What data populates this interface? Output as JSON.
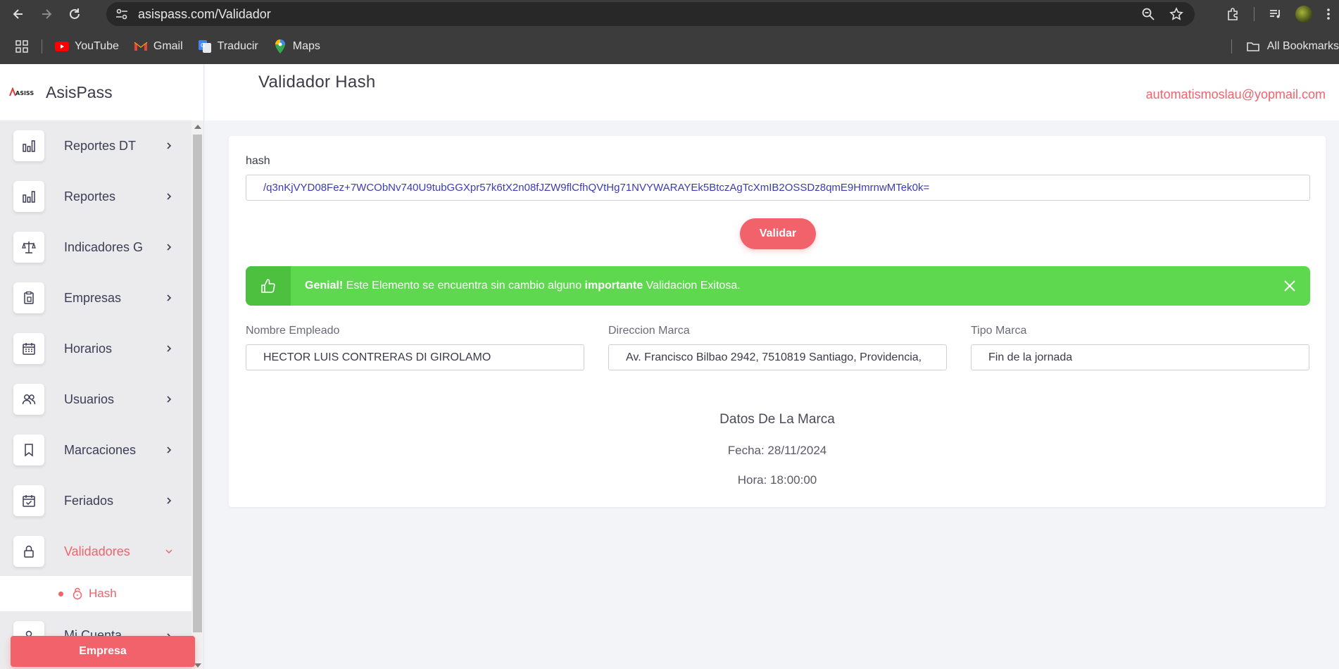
{
  "browser": {
    "url": "asispass.com/Validador",
    "bookmarks": [
      {
        "label": "YouTube",
        "icon": "youtube-icon"
      },
      {
        "label": "Gmail",
        "icon": "gmail-icon"
      },
      {
        "label": "Traducir",
        "icon": "translate-icon"
      },
      {
        "label": "Maps",
        "icon": "maps-icon"
      }
    ],
    "all_bookmarks_label": "All Bookmarks"
  },
  "brand": {
    "name": "AsisPass",
    "logo_text": "ASISS"
  },
  "sidebar": {
    "items": [
      {
        "label": "Reportes DT",
        "icon": "bar-chart-icon"
      },
      {
        "label": "Reportes",
        "icon": "bar-chart-icon"
      },
      {
        "label": "Indicadores G",
        "icon": "scale-icon"
      },
      {
        "label": "Empresas",
        "icon": "clipboard-icon"
      },
      {
        "label": "Horarios",
        "icon": "calendar-icon"
      },
      {
        "label": "Usuarios",
        "icon": "users-icon"
      },
      {
        "label": "Marcaciones",
        "icon": "bookmark-icon"
      },
      {
        "label": "Feriados",
        "icon": "calendar-check-icon"
      },
      {
        "label": "Validadores",
        "icon": "lock-icon"
      }
    ],
    "submenu": {
      "label": "Hash"
    },
    "partial_item": "Mi Cuenta",
    "footer_button": "Empresa"
  },
  "header": {
    "title": "Validador Hash",
    "user_email": "automatismoslau@yopmail.com"
  },
  "form": {
    "hash_label": "hash",
    "hash_value": "/q3nKjVYD08Fez+7WCObNv740U9tubGGXpr57k6tX2n08fJZW9flCfhQVtHg71NVYWARAYEk5BtczAgTcXmIB2OSSDz8qmE9HmrnwMTek0k=",
    "validate_button": "Validar"
  },
  "alert": {
    "strong1": "Genial!",
    "text1": " Este Elemento se encuentra sin cambio alguno ",
    "strong2": "importante",
    "text2": " Validacion Exitosa.",
    "color": "#5ed84f"
  },
  "fields": {
    "nombre_label": "Nombre Empleado",
    "nombre_value": "HECTOR LUIS  CONTRERAS DI GIROLAMO",
    "direccion_label": "Direccion Marca",
    "direccion_value": "Av. Francisco Bilbao 2942, 7510819 Santiago, Providencia,",
    "tipo_label": "Tipo Marca",
    "tipo_value": "Fin de la jornada"
  },
  "marca": {
    "title": "Datos De La Marca",
    "fecha": "Fecha: 28/11/2024",
    "hora": "Hora: 18:00:00"
  },
  "colors": {
    "accent": "#f2626b",
    "success": "#5ed84f"
  }
}
